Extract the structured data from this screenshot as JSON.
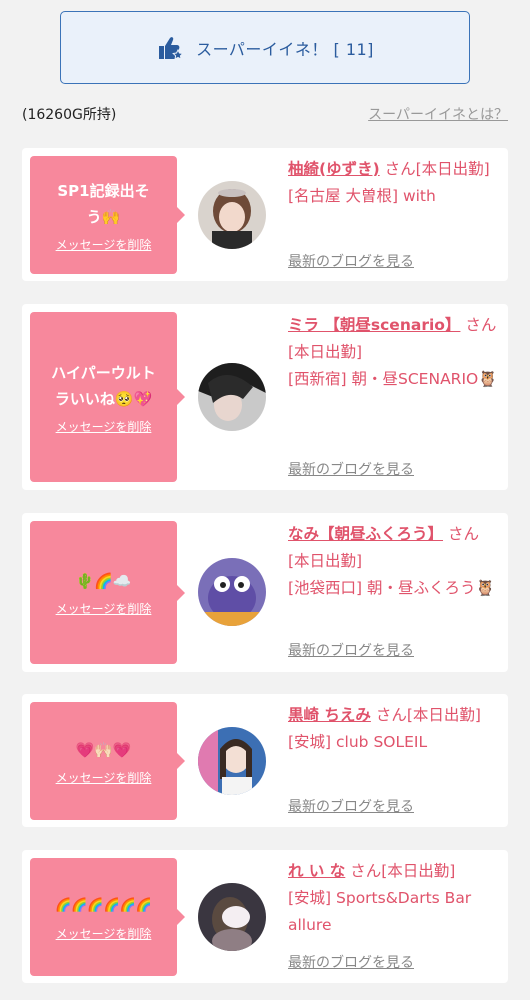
{
  "header": {
    "super_button_label": "スーパーイイネ！ [ 11]",
    "gold_text": "(16260G所持)",
    "about_link": "スーパーイイネとは？"
  },
  "colors": {
    "accent_pink": "#f7889c",
    "name_pink": "#e0536b",
    "button_blue": "#3b73b8"
  },
  "cards": [
    {
      "message": "SP1記録出そう🙌",
      "delete_label": "メッセージを削除",
      "name": "柚綺(ゆずき)",
      "suffix": " さん[本日出勤]",
      "location": "[名古屋 大曽根] with",
      "blog_link": "最新のブログを見る"
    },
    {
      "message": "ハイパーウルトラいいね🥺💖",
      "delete_label": "メッセージを削除",
      "name": "ミラ 【朝昼scenario】",
      "suffix": " さん[本日出勤]",
      "location": "[西新宿] 朝・昼SCENARIO🦉",
      "blog_link": "最新のブログを見る"
    },
    {
      "message": "🌵🌈☁️",
      "delete_label": "メッセージを削除",
      "name": "なみ【朝昼ふくろう】",
      "suffix": " さん[本日出勤]",
      "location": "[池袋西口] 朝・昼ふくろう🦉",
      "blog_link": "最新のブログを見る"
    },
    {
      "message": "💗🙌🏻💗",
      "delete_label": "メッセージを削除",
      "name": "黒崎 ちえみ",
      "suffix": " さん[本日出勤]",
      "location": "[安城] club SOLEIL",
      "blog_link": "最新のブログを見る"
    },
    {
      "message": "🌈🌈🌈🌈🌈🌈",
      "delete_label": "メッセージを削除",
      "name": "れ い な",
      "suffix": " さん[本日出勤]",
      "location": "[安城] Sports&Darts Bar allure",
      "blog_link": "最新のブログを見る"
    }
  ]
}
